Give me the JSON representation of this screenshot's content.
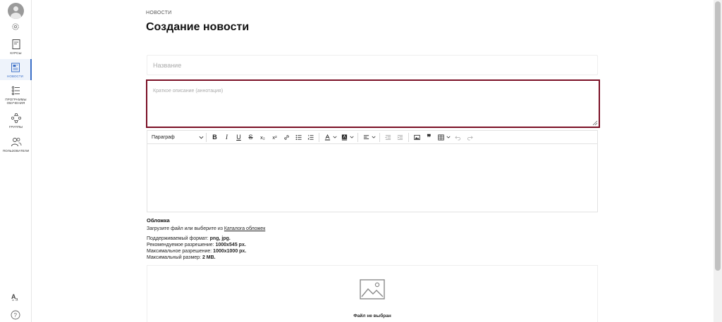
{
  "sidebar": {
    "items": [
      {
        "label": "КУРСЫ",
        "active": false
      },
      {
        "label": "НОВОСТИ",
        "active": true
      },
      {
        "label": "ПРОГРАММЫ ОБУЧЕНИЯ",
        "active": false
      },
      {
        "label": "ГРУППЫ",
        "active": false
      },
      {
        "label": "ПОЛЬЗОВАТЕЛИ",
        "active": false
      }
    ],
    "accent_color": "#3b6fc7"
  },
  "breadcrumb": "НОВОСТИ",
  "page_title": "Создание новости",
  "form": {
    "title_placeholder": "Название",
    "title_value": "",
    "annotation_placeholder": "Краткое описание (аннотация)",
    "annotation_value": "",
    "highlight_color": "#7a0f25"
  },
  "toolbar": {
    "format_select": "Параграф",
    "subscript_label": "x₂",
    "superscript_label": "x²"
  },
  "cover": {
    "title": "Обложка",
    "upload_text": "Загрузите файл или выберите из ",
    "catalog_link": "Каталога обложек",
    "format_label": "Поддерживаемый формат: ",
    "format_value": "png, jpg.",
    "rec_label": "Рекомендуемое разрешение: ",
    "rec_value": "1000x545 px.",
    "max_res_label": "Максимальное разрешение: ",
    "max_res_value": "1000x1000 px.",
    "max_size_label": "Максимальный размер: ",
    "max_size_value": "2 MB.",
    "no_file": "Файл не выбран"
  }
}
